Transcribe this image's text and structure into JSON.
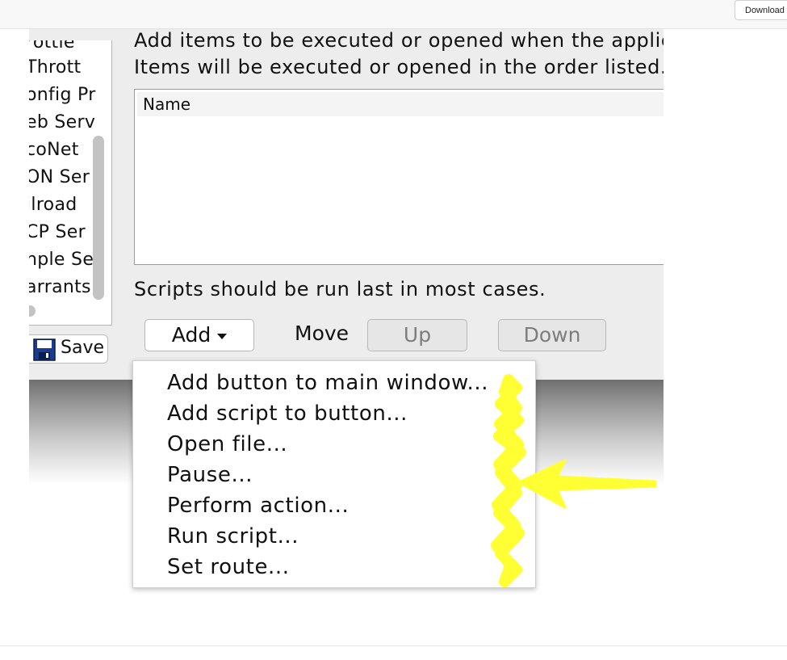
{
  "browser": {
    "download_label": "Download"
  },
  "sidebar": {
    "items": [
      "rottle",
      "Thrott",
      "onfig Pr",
      "eb Serv",
      "coNet",
      "ON Ser",
      "ilroad",
      "CP Ser",
      "nple Se",
      "arrants"
    ]
  },
  "save_button": {
    "label": "Save"
  },
  "panel": {
    "description_line1": "Add items to be executed or opened when the applic",
    "description_line2": "Items will be executed or opened in the order listed.",
    "table": {
      "header_name": "Name"
    },
    "note": "Scripts should be run last in most cases.",
    "add_label": "Add",
    "move_label": "Move",
    "up_label": "Up",
    "down_label": "Down"
  },
  "add_menu": {
    "items": [
      "Add button to main window...",
      "Add script to button...",
      "Open file...",
      "Pause...",
      "Perform action...",
      "Run script...",
      "Set route..."
    ]
  },
  "colors": {
    "annotation": "#ffff33",
    "panel_bg": "#ededed"
  }
}
